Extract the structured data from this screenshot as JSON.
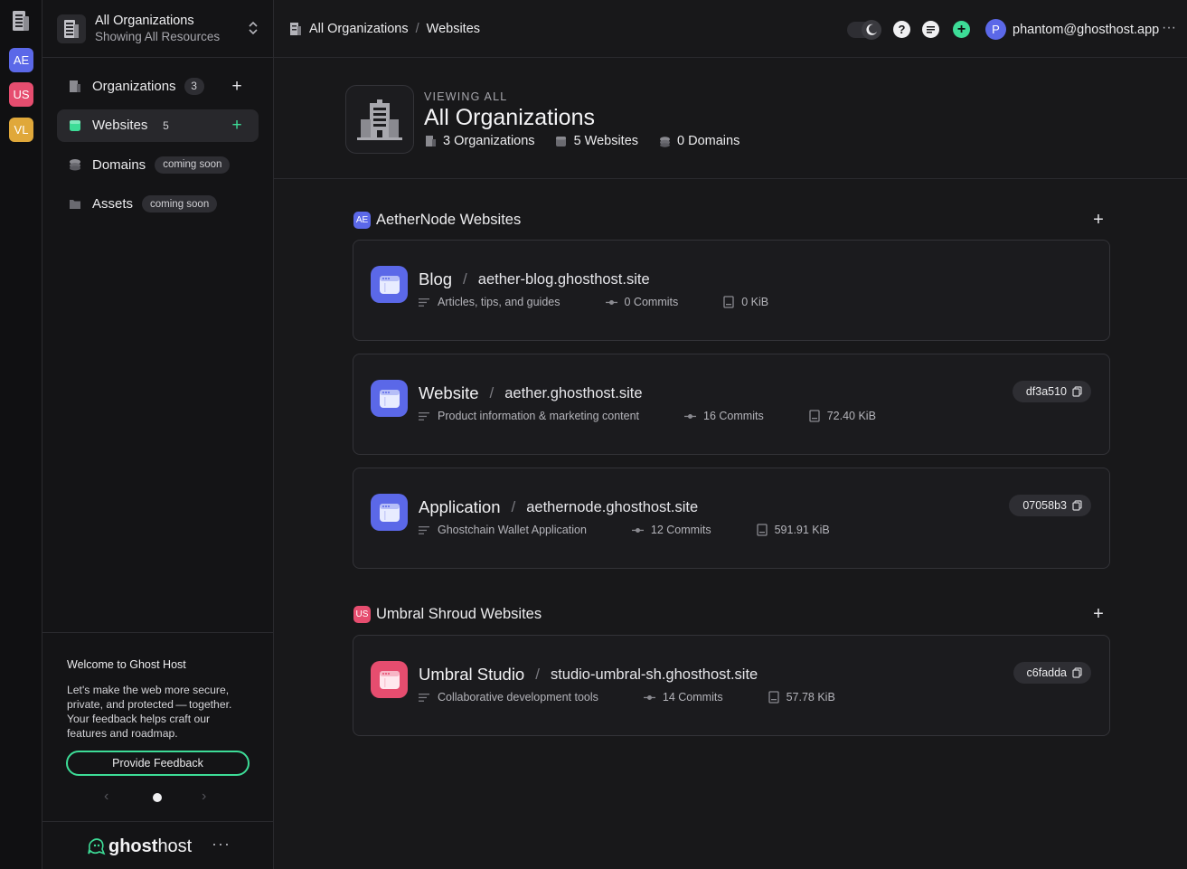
{
  "rail": {
    "orgs": [
      {
        "initials": "AE",
        "color": "#5b68e8"
      },
      {
        "initials": "US",
        "color": "#e64d6f"
      },
      {
        "initials": "VL",
        "color": "#e0a83a"
      }
    ]
  },
  "org_switcher": {
    "title": "All Organizations",
    "subtitle": "Showing All Resources"
  },
  "nav": {
    "items": [
      {
        "label": "Organizations",
        "count": "3",
        "icon": "building-icon",
        "has_add": true
      },
      {
        "label": "Websites",
        "count": "5",
        "icon": "websites-icon",
        "has_add": true,
        "active": true
      },
      {
        "label": "Domains",
        "badge": "coming soon",
        "icon": "domains-icon"
      },
      {
        "label": "Assets",
        "badge": "coming soon",
        "icon": "folder-icon"
      }
    ]
  },
  "feedback": {
    "heading": "Welcome to Ghost Host",
    "body": "Let's make the web more secure, private, and protected — together. Your feedback helps craft our features and roadmap.",
    "button": "Provide Feedback"
  },
  "brand": {
    "ghost": "ghost",
    "host": "host"
  },
  "breadcrumb": {
    "root": "All Organizations",
    "separator": "/",
    "current": "Websites"
  },
  "user": {
    "initial": "P",
    "email": "phantom@ghosthost.app"
  },
  "header": {
    "eyebrow": "VIEWING ALL",
    "title": "All Organizations",
    "stats": {
      "orgs": "3 Organizations",
      "websites": "5 Websites",
      "domains": "0 Domains"
    }
  },
  "sections": [
    {
      "badge": "AE",
      "badge_color": "#5b68e8",
      "title": "AetherNode Websites",
      "sites": [
        {
          "name": "Blog",
          "domain": "aether-blog.ghosthost.site",
          "description": "Articles, tips, and guides",
          "commits": "0 Commits",
          "size": "0 KiB",
          "hash": "",
          "color": "#5b68e8"
        },
        {
          "name": "Website",
          "domain": "aether.ghosthost.site",
          "description": "Product information & marketing content",
          "commits": "16 Commits",
          "size": "72.40 KiB",
          "hash": "df3a510",
          "color": "#5b68e8"
        },
        {
          "name": "Application",
          "domain": "aethernode.ghosthost.site",
          "description": "Ghostchain Wallet Application",
          "commits": "12 Commits",
          "size": "591.91 KiB",
          "hash": "07058b3",
          "color": "#5b68e8"
        }
      ]
    },
    {
      "badge": "US",
      "badge_color": "#e64d6f",
      "title": "Umbral Shroud Websites",
      "sites": [
        {
          "name": "Umbral Studio",
          "domain": "studio-umbral-sh.ghosthost.site",
          "description": "Collaborative development tools",
          "commits": "14 Commits",
          "size": "57.78 KiB",
          "hash": "c6fadda",
          "color": "#e64d6f"
        }
      ]
    }
  ],
  "colors": {
    "accent_green": "#3ddc97",
    "bg": "#18181a",
    "panel": "#141416"
  }
}
